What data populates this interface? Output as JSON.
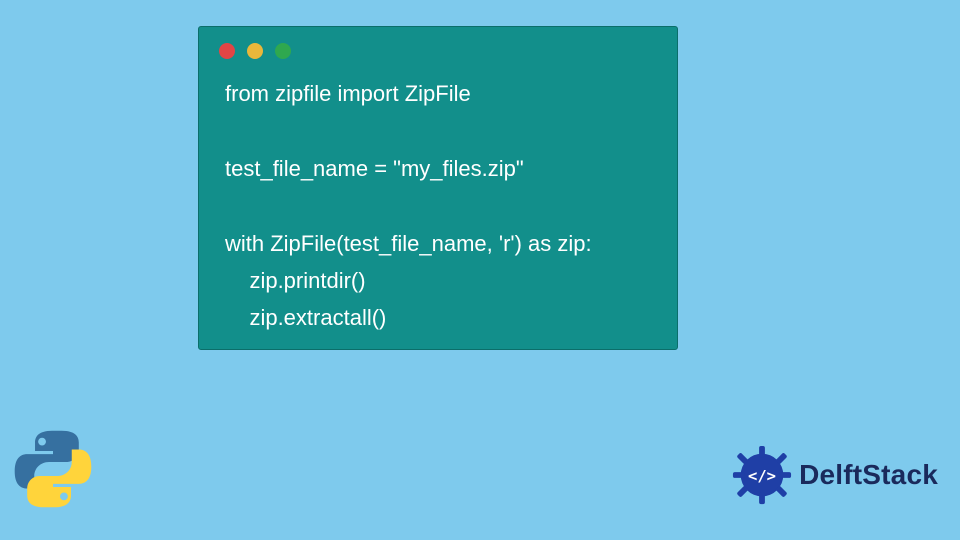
{
  "window": {
    "dots": {
      "red": "#e24545",
      "yellow": "#eab73a",
      "green": "#2fa84f"
    }
  },
  "code": {
    "line1": "from zipfile import ZipFile",
    "line2": "",
    "line3": "test_file_name = \"my_files.zip\"",
    "line4": "",
    "line5": "with ZipFile(test_file_name, 'r') as zip:",
    "line6": "    zip.printdir()",
    "line7": "    zip.extractall()"
  },
  "brand": {
    "name": "DelftStack"
  },
  "icons": {
    "python": "python-logo-icon",
    "brand_badge": "delftstack-badge-icon"
  }
}
